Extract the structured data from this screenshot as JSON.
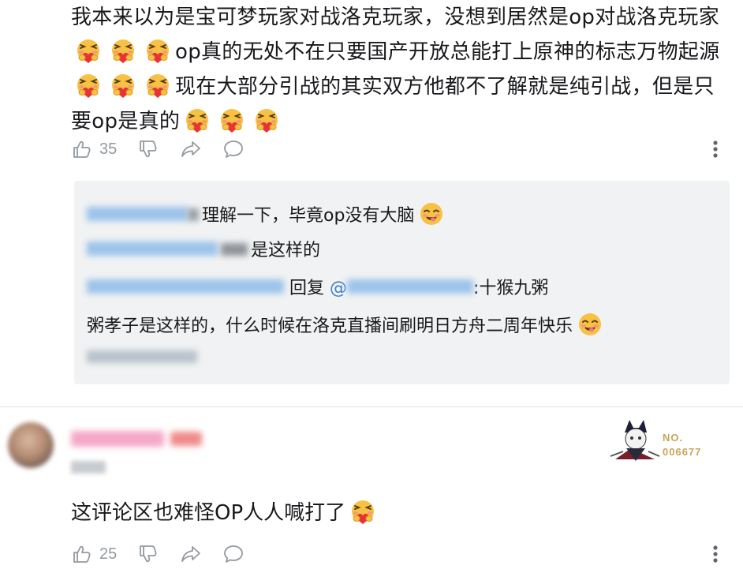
{
  "first_comment": {
    "text_1": "我本来以为是宝可梦玩家对战洛克玩家，没想到居然是op对战洛克玩家",
    "text_2": "op真的无处不在只要国产开放总能打上原神的标志万物起源",
    "text_3": "现在大部分引战的其实双方他都不了解就是纯引战，但是只要op是真的",
    "likes": "35",
    "emoji_name": "hug-heart-emoji"
  },
  "replies": [
    {
      "text": "理解一下，毕竟op没有大脑"
    },
    {
      "text": "是这样的"
    },
    {
      "reply_word": "回复",
      "at_sign": "@",
      "text": ":十猴九粥"
    },
    {
      "text": "粥孝子是这样的，什么时候在洛克直播间刷明日方舟二周年快乐"
    }
  ],
  "second_comment": {
    "badge_no_label": "NO.",
    "badge_no_value": "006677",
    "text": "这评论区也难怪OP人人喊打了",
    "likes": "25"
  },
  "colors": {
    "link": "#3c7fc8",
    "muted": "#9499a0",
    "reply_bg": "#f1f2f3",
    "divider": "#e3e5e7"
  },
  "icons": [
    "like-icon",
    "dislike-icon",
    "share-icon",
    "comment-icon",
    "more-icon"
  ]
}
